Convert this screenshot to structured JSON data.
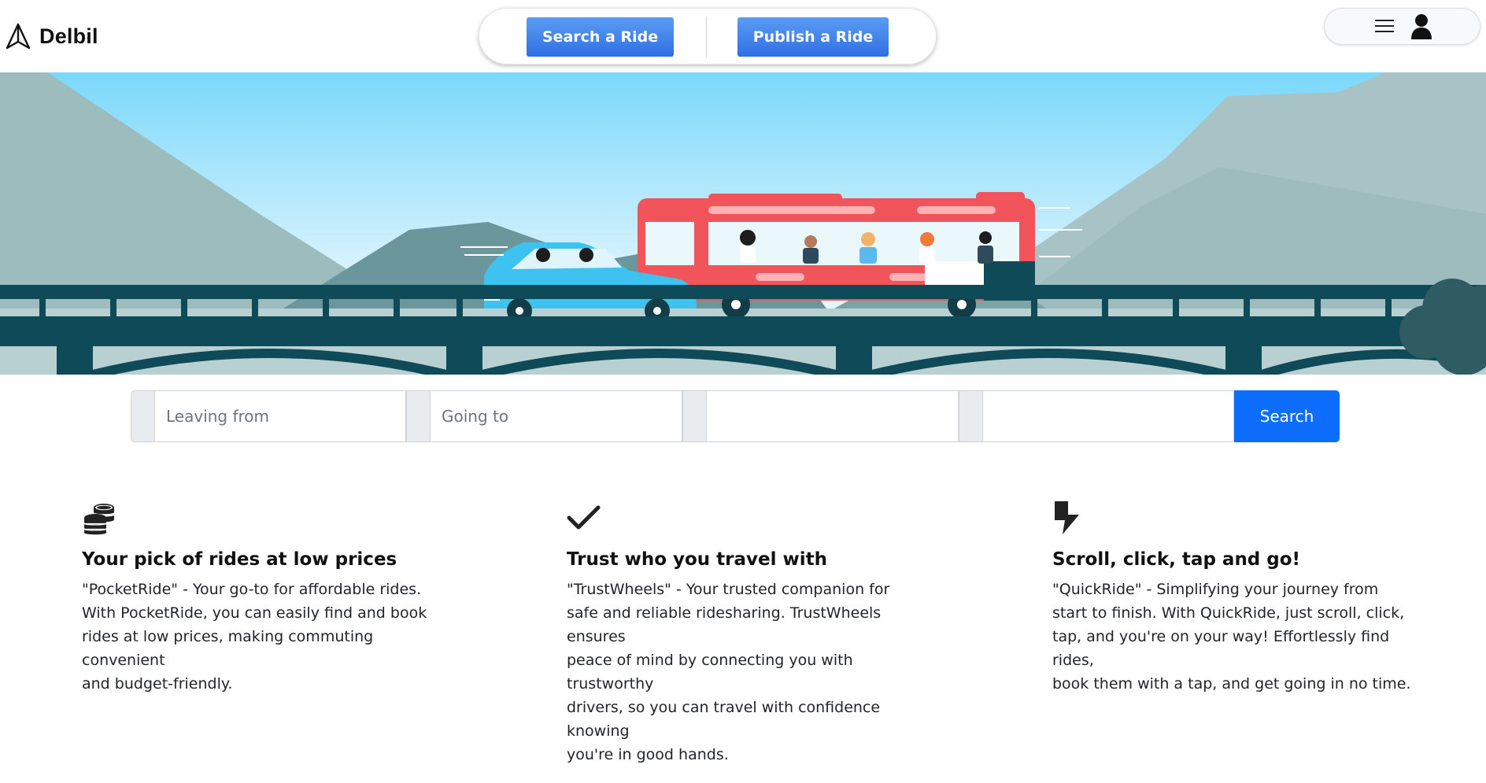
{
  "brand": {
    "name": "Delbil",
    "icon": "navigation-arrow-icon"
  },
  "nav": {
    "search_label": "Search a Ride",
    "publish_label": "Publish a Ride"
  },
  "user_menu": {
    "menu_icon": "hamburger-icon",
    "user_icon": "user-icon"
  },
  "colors": {
    "primary": "#0d6efd",
    "nav_button": "#3b7ceb",
    "bridge": "#0e4a57",
    "bus": "#f2545b",
    "car": "#3ec3f0",
    "sky_top": "#7dd9fb",
    "mountain": "#8eb0b2"
  },
  "search": {
    "leaving_placeholder": "Leaving from",
    "going_placeholder": "Going to",
    "date_value": "",
    "passengers_value": "",
    "button_label": "Search"
  },
  "features": [
    {
      "icon": "coins-icon",
      "title": "Your pick of rides at low prices",
      "lines": [
        "\"PocketRide\" - Your go-to for affordable rides.",
        "With PocketRide, you can easily find and book",
        "rides at low prices, making commuting convenient",
        "and budget-friendly."
      ]
    },
    {
      "icon": "checkmark-icon",
      "title": "Trust who you travel with",
      "lines": [
        "\"TrustWheels\" - Your trusted companion for",
        "safe and reliable ridesharing. TrustWheels ensures",
        "peace of mind by connecting you with trustworthy",
        "drivers, so you can travel with confidence knowing",
        "you're in good hands."
      ]
    },
    {
      "icon": "lightning-bolt-icon",
      "title": "Scroll, click, tap and go!",
      "lines": [
        "\"QuickRide\" - Simplifying your journey from",
        "start to finish. With QuickRide, just scroll, click,",
        "tap, and you're on your way! Effortlessly find rides,",
        "book them with a tap, and get going in no time."
      ]
    }
  ]
}
